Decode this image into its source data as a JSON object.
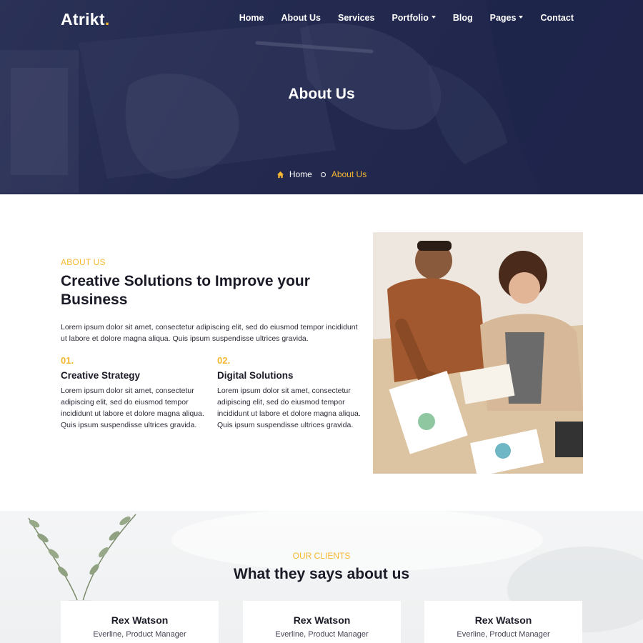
{
  "colors": {
    "accent": "#f7b731",
    "hero_overlay": "#1d224a",
    "heading": "#1b1b28"
  },
  "header": {
    "logo_text": "Atrikt",
    "logo_dot": ".",
    "nav": [
      {
        "label": "Home",
        "dropdown": false
      },
      {
        "label": "About Us",
        "dropdown": false
      },
      {
        "label": "Services",
        "dropdown": false
      },
      {
        "label": "Portfolio",
        "dropdown": true
      },
      {
        "label": "Blog",
        "dropdown": false
      },
      {
        "label": "Pages",
        "dropdown": true
      },
      {
        "label": "Contact",
        "dropdown": false
      }
    ]
  },
  "hero": {
    "title": "About Us",
    "breadcrumb": {
      "home_icon": "home-icon",
      "home": "Home",
      "current": "About Us"
    }
  },
  "about": {
    "tag": "ABOUT US",
    "heading": "Creative Solutions to Improve your Business",
    "text": "Lorem ipsum dolor sit amet, consectetur adipiscing elit, sed do eiusmod tempor incididunt ut labore et dolore magna aliqua. Quis ipsum suspendisse ultrices gravida.",
    "features": [
      {
        "number": "01.",
        "title": "Creative Strategy",
        "text": "Lorem ipsum dolor sit amet, consectetur adipiscing elit, sed do eiusmod tempor incididunt ut labore et dolore magna aliqua. Quis ipsum suspendisse ultrices gravida."
      },
      {
        "number": "02.",
        "title": "Digital Solutions",
        "text": "Lorem ipsum dolor sit amet, consectetur adipiscing elit, sed do eiusmod tempor incididunt ut labore et dolore magna aliqua. Quis ipsum suspendisse ultrices gravida."
      }
    ]
  },
  "testimonials": {
    "tag": "OUR CLIENTS",
    "heading": "What they says about us",
    "cards": [
      {
        "name": "Rex Watson",
        "role": "Everline, Product Manager"
      },
      {
        "name": "Rex Watson",
        "role": "Everline, Product Manager"
      },
      {
        "name": "Rex Watson",
        "role": "Everline, Product Manager"
      }
    ]
  }
}
